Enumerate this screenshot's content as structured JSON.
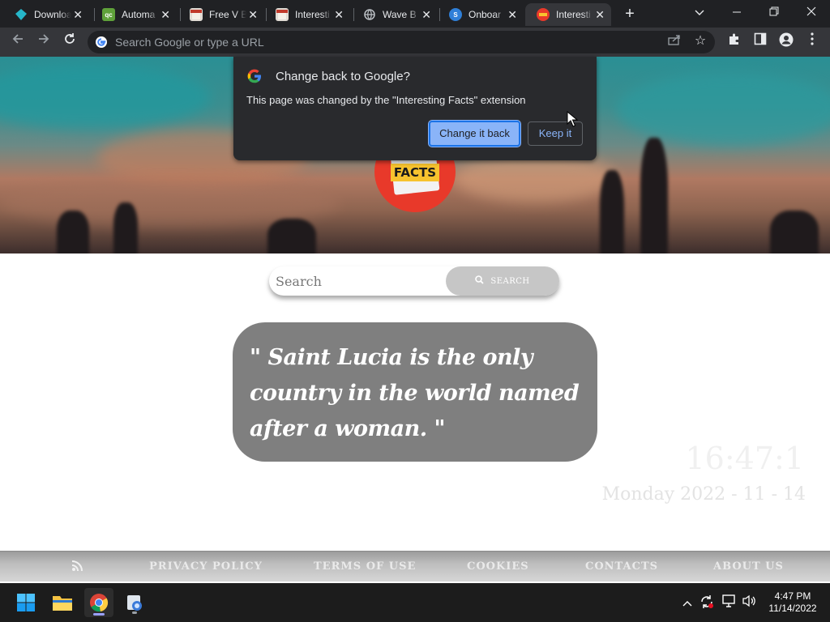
{
  "tabs": [
    {
      "title": "Download",
      "icon": "diamond-icon",
      "color": "#26b6c9"
    },
    {
      "title": "Automa",
      "icon": "automa-icon",
      "color": "#5fa13a"
    },
    {
      "title": "Free V B",
      "icon": "store-icon",
      "color": "#e0dbd4"
    },
    {
      "title": "Interesti",
      "icon": "store-icon",
      "color": "#e0dbd4"
    },
    {
      "title": "Wave B",
      "icon": "globe-icon",
      "color": "#9aa0a6"
    },
    {
      "title": "Onboar",
      "icon": "s-logo-icon",
      "color": "#2f7fd8"
    },
    {
      "title": "Interesti",
      "icon": "facts-icon",
      "color": "#e8392a",
      "active": true
    }
  ],
  "omnibox": {
    "placeholder": "Search Google or type a URL"
  },
  "popup": {
    "title": "Change back to Google?",
    "message": "This page was changed by the \"Interesting Facts\" extension",
    "primary_label": "Change it back",
    "secondary_label": "Keep it"
  },
  "logo": {
    "label": "FACTS"
  },
  "search": {
    "placeholder": "Search",
    "button_label": "SEARCH"
  },
  "fact": {
    "text": "\"  Saint Lucia is the only country in the world named after a woman.  \""
  },
  "clock": {
    "time": "16:47:1",
    "date": "Monday 2022 - 11 - 14"
  },
  "footer": {
    "links": [
      "PRIVACY POLICY",
      "TERMS OF USE",
      "COOKIES",
      "CONTACTS",
      "ABOUT US"
    ]
  },
  "taskbar": {
    "time": "4:47 PM",
    "date": "11/14/2022"
  },
  "colors": {
    "accent": "#8ab4f8",
    "chrome_dark": "#202124",
    "toolbar": "#35363a",
    "fact_card": "#7f7f7f"
  }
}
